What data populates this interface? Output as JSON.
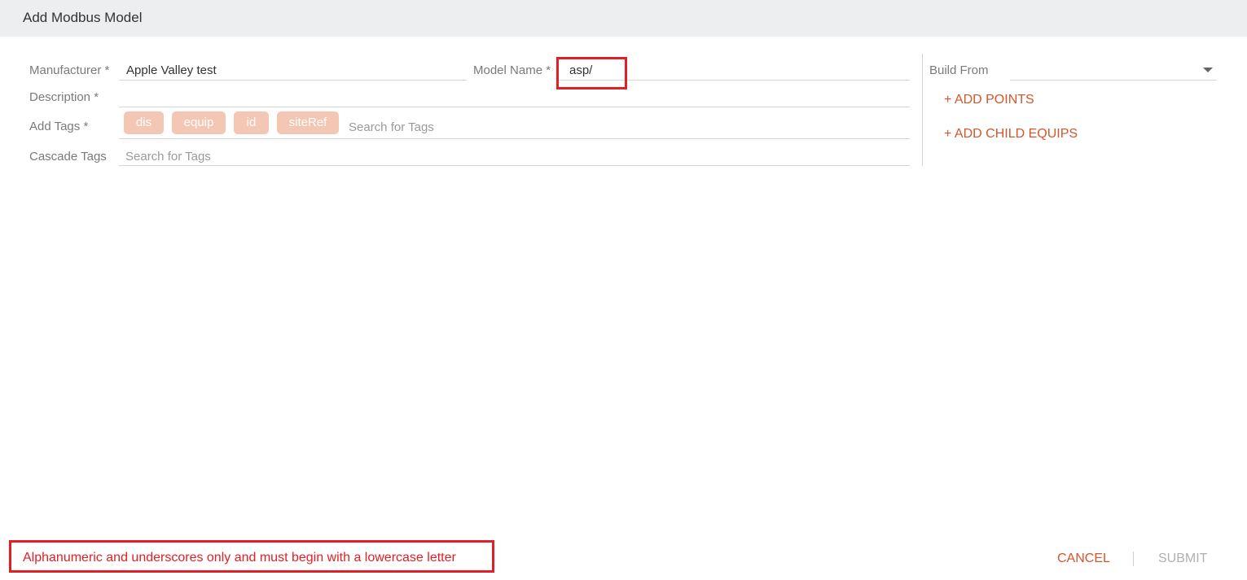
{
  "dialog": {
    "title": "Add Modbus Model"
  },
  "form": {
    "manufacturer": {
      "label": "Manufacturer *",
      "value": "Apple Valley test"
    },
    "model_name": {
      "label": "Model Name *",
      "value": "asp/"
    },
    "description": {
      "label": "Description *",
      "value": ""
    },
    "add_tags": {
      "label": "Add Tags *",
      "chips": [
        "dis",
        "equip",
        "id",
        "siteRef"
      ],
      "placeholder": "Search for Tags"
    },
    "cascade_tags": {
      "label": "Cascade Tags",
      "placeholder": "Search for Tags"
    }
  },
  "side_panel": {
    "build_from": {
      "label": "Build From",
      "value": ""
    },
    "add_points_label": "+ ADD POINTS",
    "add_child_equips_label": "+ ADD CHILD EQUIPS"
  },
  "footer": {
    "error_message": "Alphanumeric and underscores only and must begin with a lowercase letter",
    "cancel_label": "CANCEL",
    "submit_label": "SUBMIT"
  },
  "colors": {
    "accent": "#d2562b",
    "error": "#e02026",
    "chip_bg": "#f3c7b3",
    "header_bg": "#eceef0",
    "disabled": "#b0b0b0"
  },
  "icons": {
    "build_from_dropdown": "chevron-down-icon"
  }
}
